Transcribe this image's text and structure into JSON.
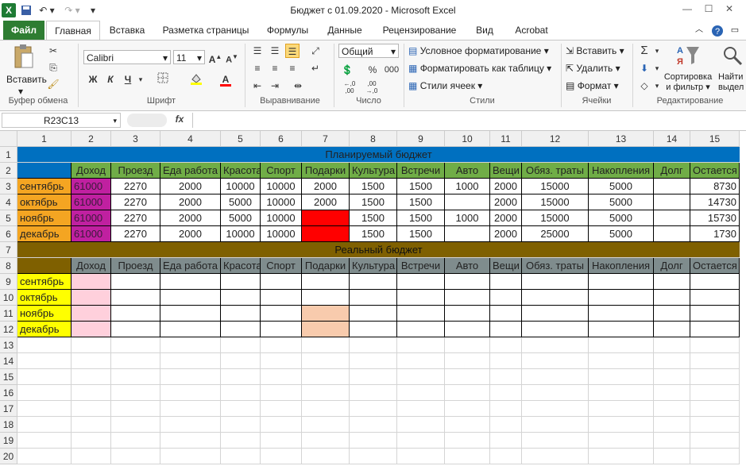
{
  "window": {
    "title": "Бюджет с 01.09.2020  -  Microsoft Excel",
    "controls": [
      "—",
      "☐",
      "✕"
    ]
  },
  "tabs": [
    "Файл",
    "Главная",
    "Вставка",
    "Разметка страницы",
    "Формулы",
    "Данные",
    "Рецензирование",
    "Вид",
    "Acrobat"
  ],
  "ribbon": {
    "groups": [
      "Буфер обмена",
      "Шрифт",
      "Выравнивание",
      "Число",
      "Стили",
      "Ячейки",
      "Редактирование"
    ],
    "paste_label": "Вставить",
    "font_name": "Calibri",
    "font_size": "11",
    "number_format": "Общий",
    "percent": "%",
    "thousands": "000",
    "dec_inc": "←,0 ,00",
    "dec_dec": ",00 →,0",
    "cond_format": "Условное форматирование",
    "format_table": "Форматировать как таблицу",
    "cell_styles": "Стили ячеек",
    "insert": "Вставить",
    "delete": "Удалить",
    "format": "Формат",
    "sort_filter": "Сортировка и фильтр",
    "sort_filter_line1": "Сортировка",
    "sort_filter_line2": "и фильтр",
    "find_select_line1": "Найти",
    "find_select_line2": "выдел",
    "bold": "Ж",
    "italic": "К",
    "underline": "Ч",
    "sigma": "Σ"
  },
  "formula_bar": {
    "name_box": "R23C13",
    "fx": "fx",
    "content": ""
  },
  "grid": {
    "col_headers": [
      "1",
      "2",
      "3",
      "4",
      "5",
      "6",
      "7",
      "8",
      "9",
      "10",
      "11",
      "12",
      "13",
      "14",
      "15"
    ],
    "row_headers": [
      "1",
      "2",
      "3",
      "4",
      "5",
      "6",
      "7",
      "8",
      "9",
      "10",
      "11",
      "12",
      "13",
      "14",
      "15",
      "16",
      "17",
      "18",
      "19",
      "20"
    ],
    "plan_title": "Планируемый бюджет",
    "real_title": "Реальный бюджет",
    "headers": [
      "",
      "Доход",
      "Проезд",
      "Еда работа",
      "Красота",
      "Спорт",
      "Подарки",
      "Культура",
      "Встречи",
      "Авто",
      "Вещи",
      "Обяз. траты",
      "Накопления",
      "Долг",
      "Остается"
    ],
    "plan_rows": [
      [
        "сентябрь",
        "61000",
        "2270",
        "2000",
        "10000",
        "10000",
        "2000",
        "1500",
        "1500",
        "1000",
        "2000",
        "15000",
        "5000",
        "",
        "8730"
      ],
      [
        "октябрь",
        "61000",
        "2270",
        "2000",
        "5000",
        "10000",
        "2000",
        "1500",
        "1500",
        "",
        "2000",
        "15000",
        "5000",
        "",
        "14730"
      ],
      [
        "ноябрь",
        "61000",
        "2270",
        "2000",
        "5000",
        "10000",
        "",
        "1500",
        "1500",
        "1000",
        "2000",
        "15000",
        "5000",
        "",
        "15730"
      ],
      [
        "декабрь",
        "61000",
        "2270",
        "2000",
        "10000",
        "10000",
        "",
        "1500",
        "1500",
        "",
        "2000",
        "25000",
        "5000",
        "",
        "1730"
      ]
    ],
    "real_months": [
      "сентябрь",
      "октябрь",
      "ноябрь",
      "декабрь"
    ]
  },
  "colors": {
    "title_blue": "#0070c0",
    "header_green": "#70ad47",
    "month_orange": "#f4a522",
    "income_purple": "#c020a0",
    "gift_red": "#ff0000",
    "real_brown": "#7f6000",
    "real_header": "#7f8c8d",
    "month_yellow": "#ffff00",
    "income_pink": "#ffd0dc",
    "gift_peach": "#f8cbad"
  }
}
